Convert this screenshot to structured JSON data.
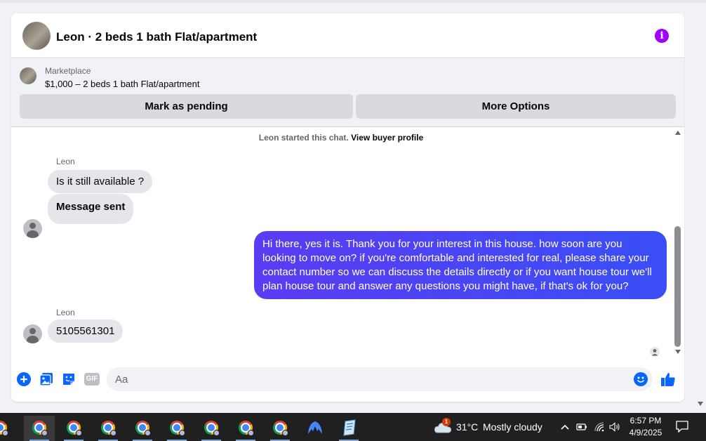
{
  "header": {
    "title": "Leon · 2 beds 1 bath Flat/apartment",
    "info_icon": "info-icon",
    "accent_color": "#a100ff"
  },
  "listing": {
    "label": "Marketplace",
    "item": "$1,000 – 2 beds 1 bath Flat/apartment",
    "mark_pending_label": "Mark as pending",
    "more_options_label": "More Options"
  },
  "conversation": {
    "started_text": "Leon started this chat.",
    "buyer_profile_link": "View buyer profile",
    "messages": [
      {
        "sender": "Leon",
        "direction": "incoming",
        "text": "Is it still available ?"
      },
      {
        "sender": "",
        "direction": "incoming",
        "text": "Message sent"
      },
      {
        "sender": "",
        "direction": "outgoing",
        "text": "Hi there, yes it is. Thank you for your interest in this house. how soon are you looking to move on? if you're comfortable and interested for real, please share your contact number so we can discuss the details directly or if you want house tour we'll plan house tour and answer any questions you might have, if that's ok for you?"
      },
      {
        "sender": "Leon",
        "direction": "incoming",
        "text": "5105561301"
      }
    ],
    "outgoing_color": "#4a45f3"
  },
  "composer": {
    "placeholder": "Aa",
    "value": "",
    "icons": [
      "plus-icon",
      "photo-icon",
      "sticker-icon",
      "gif-icon",
      "emoji-icon",
      "thumbs-up-icon"
    ],
    "gif_label": "GIF"
  },
  "taskbar": {
    "apps": [
      "chrome",
      "chrome",
      "chrome",
      "chrome",
      "chrome",
      "chrome",
      "chrome",
      "chrome",
      "chrome",
      "nordvpn",
      "notepad"
    ],
    "weather_badge": "1",
    "temperature": "31°C",
    "condition": "Mostly cloudy",
    "time": "6:57 PM",
    "date": "4/9/2025"
  }
}
